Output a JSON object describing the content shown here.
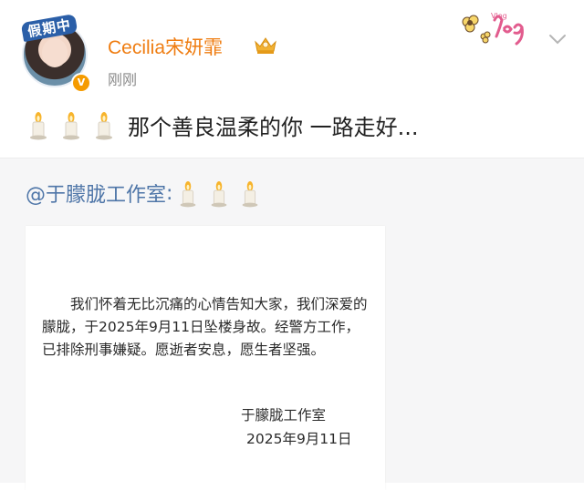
{
  "post": {
    "avatar_tag": "假期中",
    "username": "Cecilia宋妍霏",
    "timestamp": "刚刚",
    "sticker_text": "Vlog",
    "text": "那个善良温柔的你 一路走好..."
  },
  "repost": {
    "author": "@于朦胧工作室",
    "colon": ":",
    "notice": {
      "body": "我们怀着无比沉痛的心情告知大家，我们深爱的朦胧，于2025年9月11日坠楼身故。经警方工作，已排除刑事嫌疑。愿逝者安息，愿生者坚强。",
      "signature": "于朦胧工作室",
      "date": "2025年9月11日"
    }
  },
  "icons": {
    "candle": "candle-emoji-icon",
    "crown": "crown-badge-icon",
    "verified": "verified-badge-icon",
    "more": "chevron-down-icon"
  },
  "colors": {
    "username": "#ef7d12",
    "repost_author": "#4f76a8",
    "repost_bg": "#f6f6f7",
    "timestamp": "#8a8a8a"
  }
}
